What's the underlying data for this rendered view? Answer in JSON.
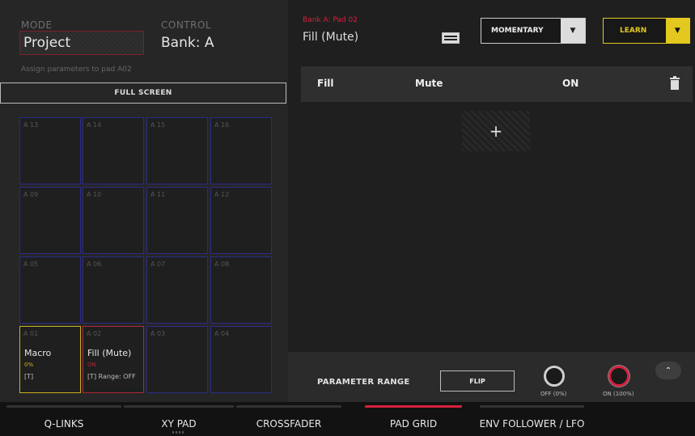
{
  "left_panel": {
    "mode_label": "MODE",
    "mode_value": "Project",
    "control_label": "CONTROL",
    "control_value": "Bank: A",
    "hint": "Assign parameters to pad A02",
    "full_screen_label": "FULL SCREEN"
  },
  "pads": [
    {
      "num": "A 13",
      "name": "",
      "val": "",
      "meta": ""
    },
    {
      "num": "A 14",
      "name": "",
      "val": "",
      "meta": ""
    },
    {
      "num": "A 15",
      "name": "",
      "val": "",
      "meta": ""
    },
    {
      "num": "A 16",
      "name": "",
      "val": "",
      "meta": ""
    },
    {
      "num": "A 09",
      "name": "",
      "val": "",
      "meta": ""
    },
    {
      "num": "A 10",
      "name": "",
      "val": "",
      "meta": ""
    },
    {
      "num": "A 11",
      "name": "",
      "val": "",
      "meta": ""
    },
    {
      "num": "A 12",
      "name": "",
      "val": "",
      "meta": ""
    },
    {
      "num": "A 05",
      "name": "",
      "val": "",
      "meta": ""
    },
    {
      "num": "A 06",
      "name": "",
      "val": "",
      "meta": ""
    },
    {
      "num": "A 07",
      "name": "",
      "val": "",
      "meta": ""
    },
    {
      "num": "A 08",
      "name": "",
      "val": "",
      "meta": ""
    },
    {
      "num": "A 01",
      "name": "Macro",
      "val": "0%",
      "meta": "[T]"
    },
    {
      "num": "A 02",
      "name": "Fill (Mute)",
      "val": "ON",
      "meta": "[T] Range: OFF"
    },
    {
      "num": "A 03",
      "name": "",
      "val": "",
      "meta": ""
    },
    {
      "num": "A 04",
      "name": "",
      "val": "",
      "meta": ""
    }
  ],
  "right_panel": {
    "bank_pad": "Bank A: Pad 02",
    "pad_title": "Fill (Mute)",
    "mode_dropdown": "MOMENTARY",
    "learn_label": "LEARN",
    "assignment": {
      "target": "Fill",
      "param": "Mute",
      "value": "ON"
    },
    "add_label": "+",
    "range": {
      "label": "PARAMETER RANGE",
      "flip_label": "FLIP",
      "min_label": "OFF (0%)",
      "max_label": "ON (100%)"
    }
  },
  "tabs": [
    {
      "label": "Q-LINKS",
      "active": false
    },
    {
      "label": "XY PAD",
      "active": false
    },
    {
      "label": "CROSSFADER",
      "active": false
    },
    {
      "label": "PAD GRID",
      "active": true
    },
    {
      "label": "ENV FOLLOWER / LFO",
      "active": false
    }
  ],
  "colors": {
    "accent_red": "#d6203c",
    "learn_yellow": "#e3c820",
    "pad_border_blue": "#2a2a8a",
    "macro_yellow": "#c9b022",
    "value_yellow": "#d2b021",
    "value_red": "#b3263a"
  }
}
